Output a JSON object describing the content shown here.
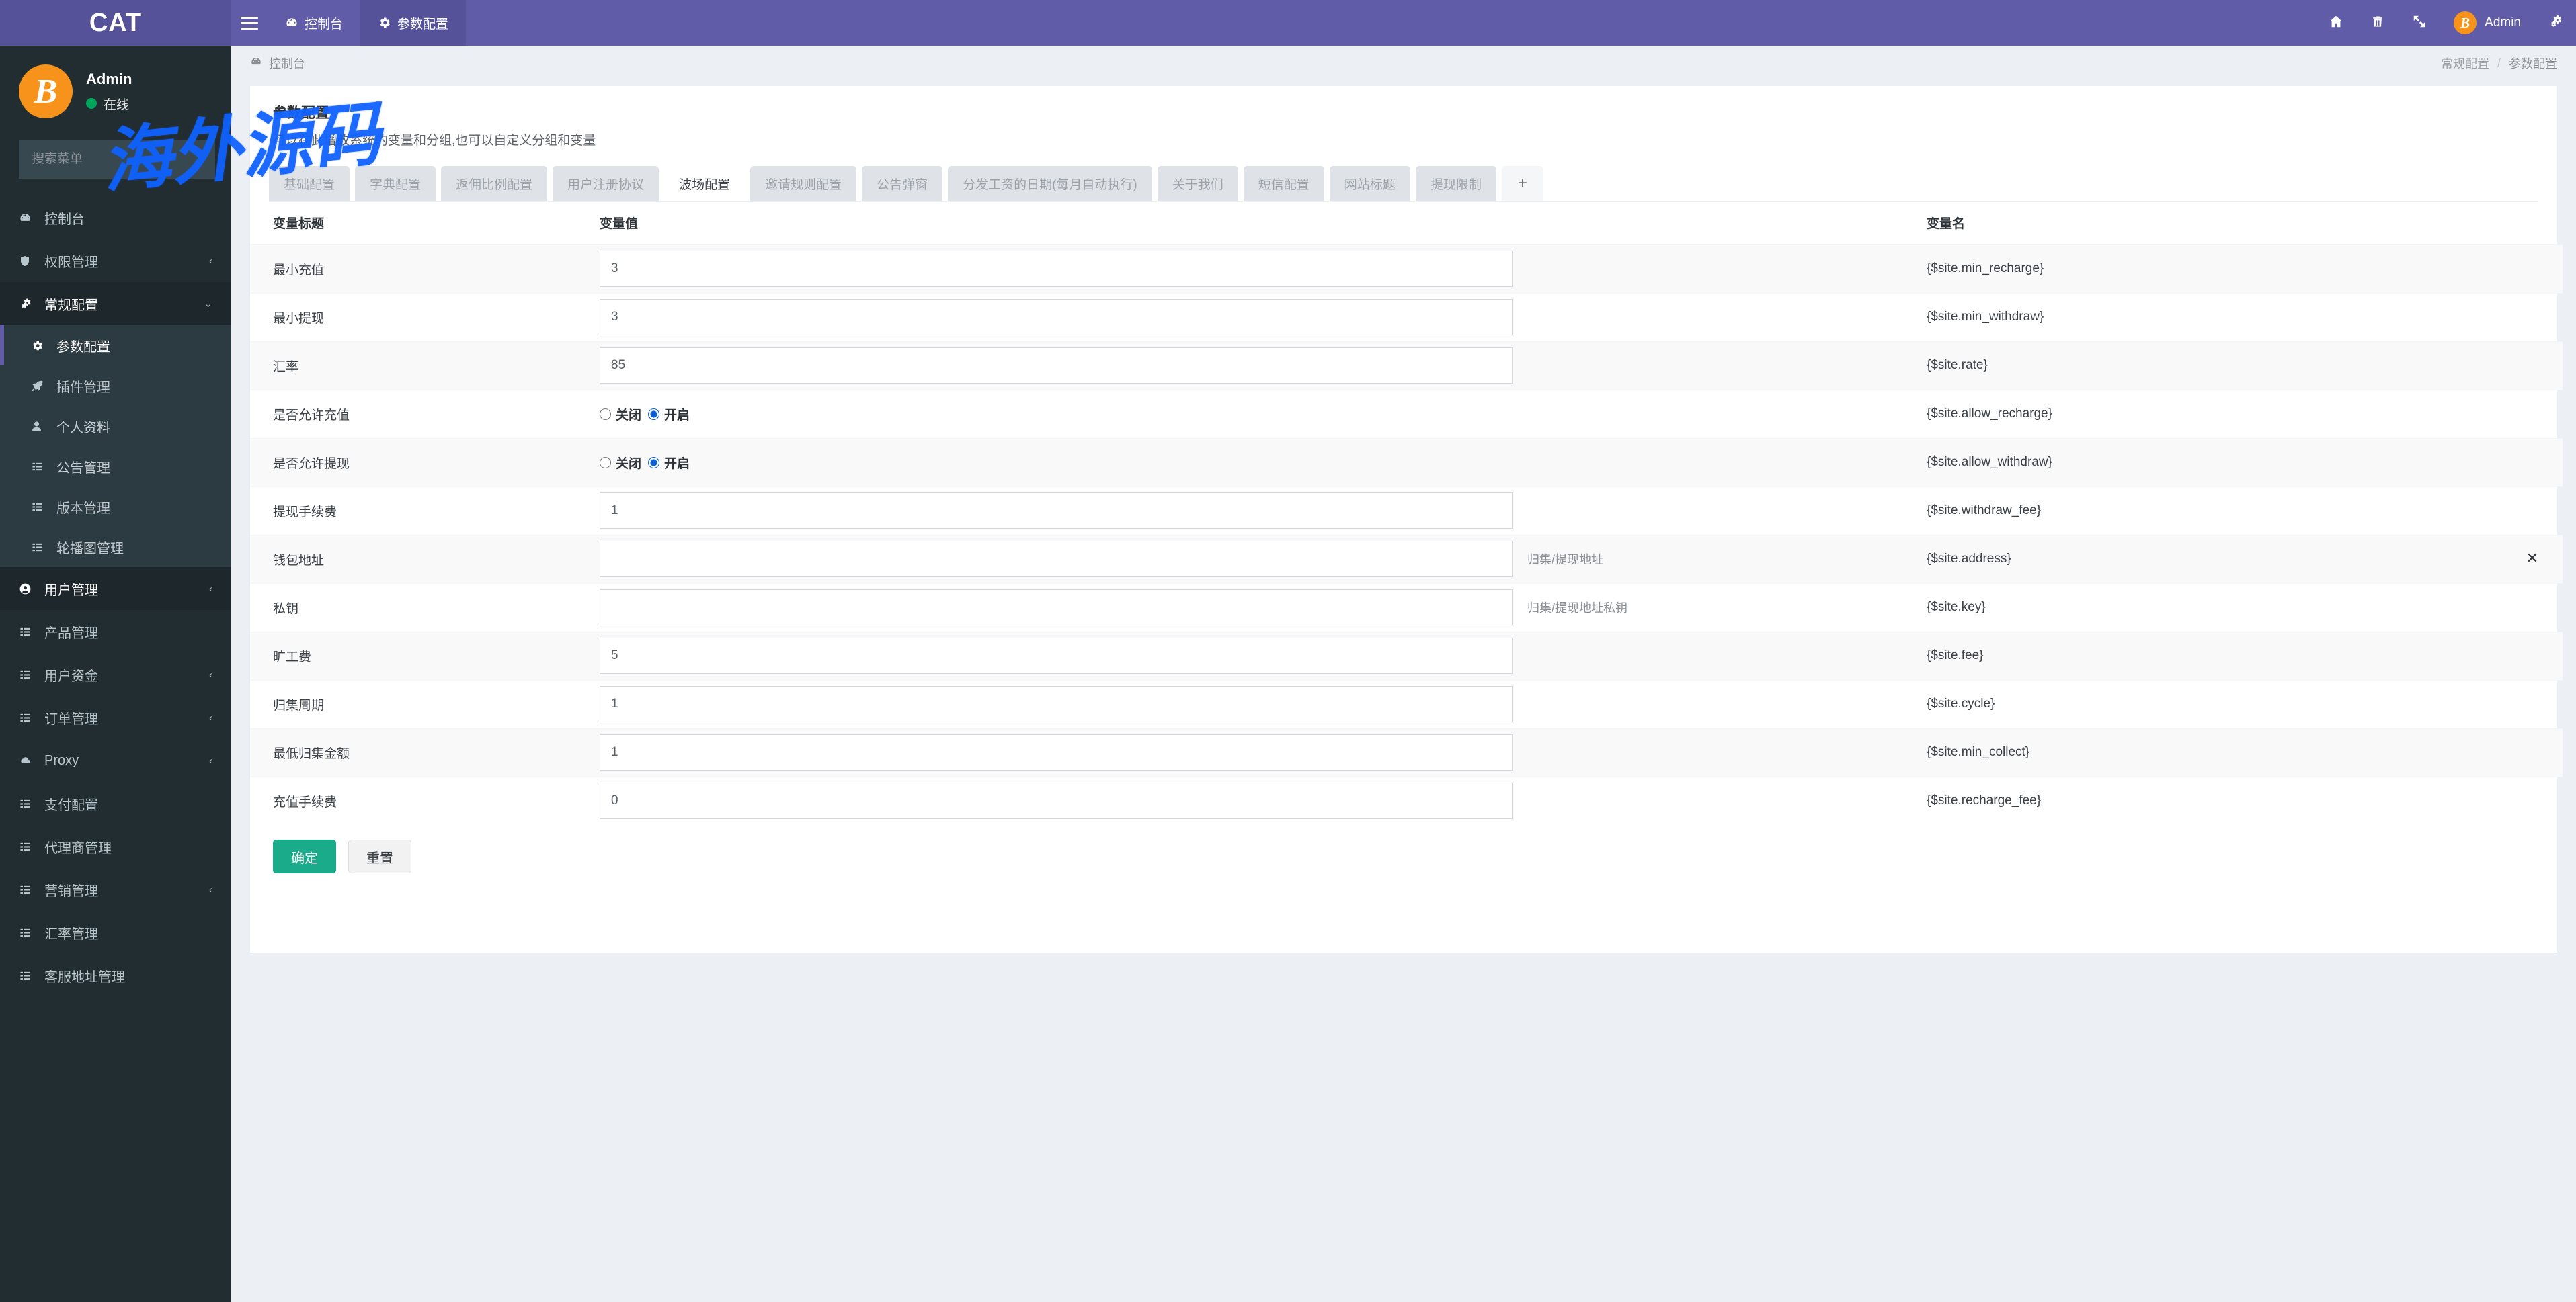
{
  "app": {
    "logo": "CAT",
    "watermark": "海外源码"
  },
  "topnav": {
    "toggle_icon": "hamburger-icon",
    "tabs": [
      {
        "label": "控制台",
        "icon": "dashboard-icon",
        "active": false
      },
      {
        "label": "参数配置",
        "icon": "gear-icon",
        "active": true
      }
    ],
    "right_icons": [
      {
        "name": "home-icon",
        "glyph": "home"
      },
      {
        "name": "trash-icon",
        "glyph": "trash"
      },
      {
        "name": "fullscreen-icon",
        "glyph": "expand"
      }
    ],
    "user": {
      "name": "Admin",
      "avatar": "bitcoin-icon"
    },
    "settings_icon": "gears-icon"
  },
  "sidebar": {
    "user": {
      "name": "Admin",
      "status": "在线",
      "avatar": "bitcoin-icon"
    },
    "search_placeholder": "搜索菜单",
    "items": [
      {
        "label": "控制台",
        "icon": "dashboard-icon",
        "arrow": "",
        "state": "normal"
      },
      {
        "label": "权限管理",
        "icon": "shield-icon",
        "arrow": "‹",
        "state": "normal"
      },
      {
        "label": "常规配置",
        "icon": "gears-icon",
        "arrow": "⌄",
        "state": "open"
      },
      {
        "label": "参数配置",
        "icon": "gear-icon",
        "arrow": "",
        "state": "sub-active"
      },
      {
        "label": "插件管理",
        "icon": "rocket-icon",
        "arrow": "",
        "state": "sub"
      },
      {
        "label": "个人资料",
        "icon": "user-icon",
        "arrow": "",
        "state": "sub"
      },
      {
        "label": "公告管理",
        "icon": "list-icon",
        "arrow": "",
        "state": "sub"
      },
      {
        "label": "版本管理",
        "icon": "list-icon",
        "arrow": "",
        "state": "sub"
      },
      {
        "label": "轮播图管理",
        "icon": "list-icon",
        "arrow": "",
        "state": "sub"
      },
      {
        "label": "用户管理",
        "icon": "user-circle-icon",
        "arrow": "‹",
        "state": "hover"
      },
      {
        "label": "产品管理",
        "icon": "list-icon",
        "arrow": "",
        "state": "normal"
      },
      {
        "label": "用户资金",
        "icon": "list-icon",
        "arrow": "‹",
        "state": "normal"
      },
      {
        "label": "订单管理",
        "icon": "list-icon",
        "arrow": "‹",
        "state": "normal"
      },
      {
        "label": "Proxy",
        "icon": "cloud-icon",
        "arrow": "‹",
        "state": "normal"
      },
      {
        "label": "支付配置",
        "icon": "list-icon",
        "arrow": "",
        "state": "normal"
      },
      {
        "label": "代理商管理",
        "icon": "list-icon",
        "arrow": "",
        "state": "normal"
      },
      {
        "label": "营销管理",
        "icon": "list-icon",
        "arrow": "‹",
        "state": "normal"
      },
      {
        "label": "汇率管理",
        "icon": "list-icon",
        "arrow": "",
        "state": "normal"
      },
      {
        "label": "客服地址管理",
        "icon": "list-icon",
        "arrow": "",
        "state": "normal"
      }
    ]
  },
  "breadcrumb": {
    "left_icon": "dashboard-icon",
    "left_label": "控制台",
    "right": [
      "常规配置",
      "参数配置"
    ],
    "separator": "/"
  },
  "panel": {
    "title": "参数配置",
    "subtitle": "可以在此增改系统的变量和分组,也可以自定义分组和变量"
  },
  "tabs": [
    {
      "label": "基础配置",
      "active": false
    },
    {
      "label": "字典配置",
      "active": false
    },
    {
      "label": "返佣比例配置",
      "active": false
    },
    {
      "label": "用户注册协议",
      "active": false
    },
    {
      "label": "波场配置",
      "active": true
    },
    {
      "label": "邀请规则配置",
      "active": false
    },
    {
      "label": "公告弹窗",
      "active": false
    },
    {
      "label": "分发工资的日期(每月自动执行)",
      "active": false
    },
    {
      "label": "关于我们",
      "active": false
    },
    {
      "label": "短信配置",
      "active": false
    },
    {
      "label": "网站标题",
      "active": false
    },
    {
      "label": "提现限制",
      "active": false
    }
  ],
  "add_tab_label": "+",
  "table": {
    "headers": {
      "title": "变量标题",
      "value": "变量值",
      "name": "变量名"
    },
    "rows": [
      {
        "title": "最小充值",
        "type": "text",
        "value": "3",
        "placeholder": "",
        "hint": "",
        "name": "{$site.min_recharge}",
        "delete": false
      },
      {
        "title": "最小提现",
        "type": "text",
        "value": "3",
        "placeholder": "",
        "hint": "",
        "name": "{$site.min_withdraw}",
        "delete": false
      },
      {
        "title": "汇率",
        "type": "text",
        "value": "85",
        "placeholder": "",
        "hint": "",
        "name": "{$site.rate}",
        "delete": false
      },
      {
        "title": "是否允许充值",
        "type": "radio",
        "options": [
          "关闭",
          "开启"
        ],
        "selected": "开启",
        "name": "{$site.allow_recharge}",
        "delete": false
      },
      {
        "title": "是否允许提现",
        "type": "radio",
        "options": [
          "关闭",
          "开启"
        ],
        "selected": "开启",
        "name": "{$site.allow_withdraw}",
        "delete": false
      },
      {
        "title": "提现手续费",
        "type": "text",
        "value": "1",
        "placeholder": "",
        "hint": "",
        "name": "{$site.withdraw_fee}",
        "delete": false
      },
      {
        "title": "钱包地址",
        "type": "text",
        "value": "",
        "placeholder": "",
        "hint": "归集/提现地址",
        "name": "{$site.address}",
        "delete": true
      },
      {
        "title": "私钥",
        "type": "text",
        "value": "",
        "placeholder": "",
        "hint": "归集/提现地址私钥",
        "name": "{$site.key}",
        "delete": false
      },
      {
        "title": "旷工费",
        "type": "text",
        "value": "5",
        "placeholder": "",
        "hint": "",
        "name": "{$site.fee}",
        "delete": false
      },
      {
        "title": "归集周期",
        "type": "text",
        "value": "1",
        "placeholder": "",
        "hint": "",
        "name": "{$site.cycle}",
        "delete": false
      },
      {
        "title": "最低归集金额",
        "type": "text",
        "value": "1",
        "placeholder": "",
        "hint": "",
        "name": "{$site.min_collect}",
        "delete": false
      },
      {
        "title": "充值手续费",
        "type": "text",
        "value": "0",
        "placeholder": "",
        "hint": "",
        "name": "{$site.recharge_fee}",
        "delete": false
      }
    ]
  },
  "actions": {
    "submit": "确定",
    "reset": "重置"
  },
  "colors": {
    "header": "#605ca8",
    "sidebar": "#222d32",
    "accent": "#1aab8a",
    "bitcoin": "#f7931a",
    "online": "#00a65a"
  }
}
